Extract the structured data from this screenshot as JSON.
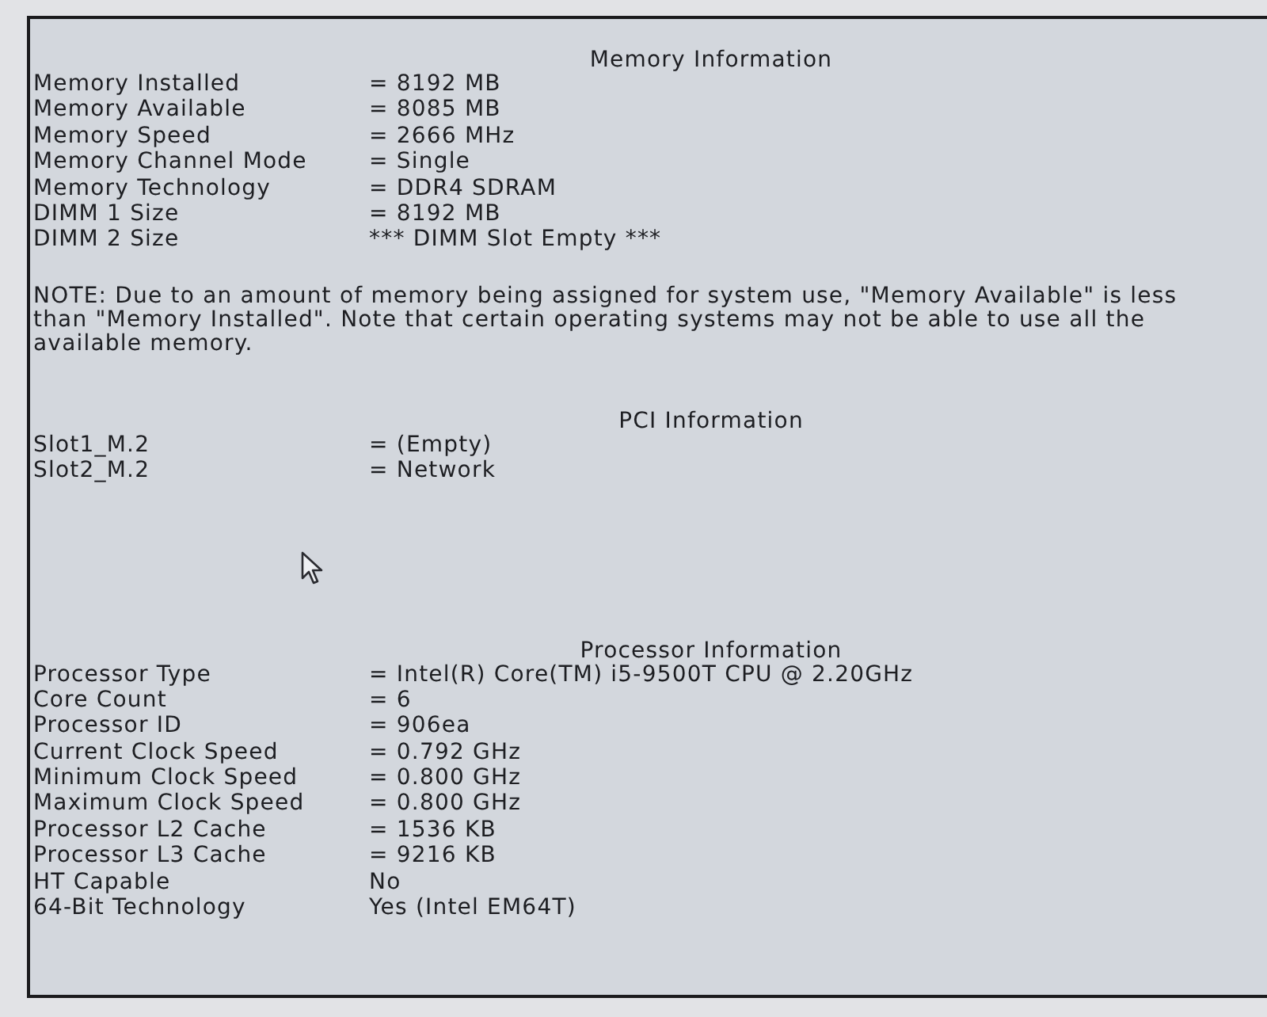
{
  "sections": [
    {
      "title": "Memory Information",
      "rows": [
        {
          "label": "Memory Installed",
          "value": "= 8192 MB"
        },
        {
          "label": "Memory Available",
          "value": "= 8085 MB"
        },
        {
          "label": "Memory Speed",
          "value": "= 2666 MHz"
        },
        {
          "label": "Memory Channel Mode",
          "value": "= Single"
        },
        {
          "label": "Memory Technology",
          "value": "= DDR4 SDRAM"
        },
        {
          "label": "DIMM 1 Size",
          "value": "= 8192 MB"
        },
        {
          "label": "DIMM 2 Size",
          "value": "*** DIMM Slot Empty ***"
        }
      ],
      "note": "NOTE: Due to an amount of memory being assigned for system use, \"Memory Available\" is less than \"Memory Installed\". Note that certain operating systems may not be able to use all the available memory."
    },
    {
      "title": "PCI Information",
      "rows": [
        {
          "label": "Slot1_M.2",
          "value": "= (Empty)"
        },
        {
          "label": "Slot2_M.2",
          "value": "= Network"
        }
      ]
    },
    {
      "title": "Processor Information",
      "rows": [
        {
          "label": "Processor Type",
          "value": "= Intel(R) Core(TM) i5-9500T CPU @ 2.20GHz"
        },
        {
          "label": "Core Count",
          "value": "= 6"
        },
        {
          "label": "Processor ID",
          "value": "= 906ea"
        },
        {
          "label": "Current Clock Speed",
          "value": "= 0.792 GHz"
        },
        {
          "label": "Minimum Clock Speed",
          "value": "= 0.800 GHz"
        },
        {
          "label": "Maximum Clock Speed",
          "value": "= 0.800 GHz"
        },
        {
          "label": "Processor L2 Cache",
          "value": "= 1536 KB"
        },
        {
          "label": "Processor L3 Cache",
          "value": "= 9216 KB"
        },
        {
          "label": "HT Capable",
          "value": "No"
        },
        {
          "label": "64-Bit Technology",
          "value": "Yes (Intel EM64T)"
        }
      ]
    }
  ]
}
